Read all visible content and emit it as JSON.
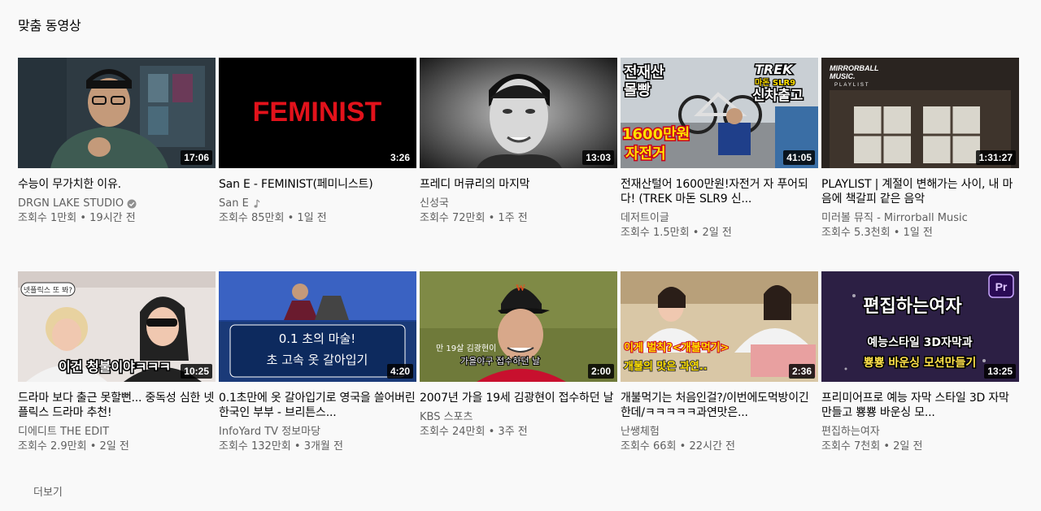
{
  "section": {
    "title": "맞춤 동영상",
    "more_label": "더보기"
  },
  "videos": [
    {
      "title": "수능이 무가치한 이유.",
      "channel": "DRGN LAKE STUDIO",
      "badge": "verified-icon",
      "views": "조회수 1만회",
      "age": "19시간 전",
      "duration": "17:06"
    },
    {
      "title": "San E - FEMINIST(페미니스트)",
      "channel": "San E",
      "badge": "music-note-icon",
      "views": "조회수 85만회",
      "age": "1일 전",
      "duration": "3:26",
      "thumb_text": "FEMINIST"
    },
    {
      "title": "프레디 머큐리의 마지막",
      "channel": "신성국",
      "views": "조회수 72만회",
      "age": "1주 전",
      "duration": "13:03"
    },
    {
      "title": "전재산털어 1600만원!자전거 자 푸어되다! (TREK 마돈 SLR9 신...",
      "channel": "데저트이글",
      "views": "조회수 1.5만회",
      "age": "2일 전",
      "duration": "41:05",
      "thumb_text": [
        "전재산",
        "몰빵",
        "TREK",
        "마돈 SLR9",
        "신차출고",
        "1600만원",
        "자전거"
      ]
    },
    {
      "title": "PLAYLIST | 계절이 변해가는 사이, 내 마음에 책갈피 같은 음악",
      "channel": "미러볼 뮤직 - Mirrorball Music",
      "views": "조회수 5.3천회",
      "age": "1일 전",
      "duration": "1:31:27",
      "thumb_text": [
        "MIRRORBALL",
        "MUSIC.",
        "PLAYLIST"
      ]
    },
    {
      "title": "드라마 보다 출근 못할뻔... 중독성 심한 넷플릭스 드라마 추천!",
      "channel": "디에디트 THE EDIT",
      "views": "조회수 2.9만회",
      "age": "2일 전",
      "duration": "10:25",
      "thumb_text": [
        "넷플릭스 또 봐?",
        "이건 청불이야ㅋㅋㅋ"
      ]
    },
    {
      "title": "0.1초만에 옷 갈아입기로 영국을 쓸어버린 한국인 부부 - 브리튼스...",
      "channel": "InfoYard TV 정보마당",
      "views": "조회수 132만회",
      "age": "3개월 전",
      "duration": "4:20",
      "thumb_text": [
        "0.1 초의 마술!",
        "초 고속 옷 갈아입기"
      ]
    },
    {
      "title": "2007년 가을 19세 김광현이 접수하던 날",
      "channel": "KBS 스포츠",
      "views": "조회수 24만회",
      "age": "3주 전",
      "duration": "2:00",
      "thumb_text": [
        "만 19살 김광현이",
        "가을야구 접수하던 날"
      ]
    },
    {
      "title": "개불먹기는 처음인걸?/이번에도먹방이긴한데/ㅋㅋㅋㅋㅋ과연맛은...",
      "channel": "난쌩체험",
      "views": "조회수 66회",
      "age": "22시간 전",
      "duration": "2:36",
      "thumb_text": [
        "이게 벌칙?<개불먹기>",
        "개불의 맛은 과연.."
      ]
    },
    {
      "title": "프리미어프로 예능 자막 스타일 3D 자막 만들고 뿅뿅 바운싱 모...",
      "channel": "편집하는여자",
      "views": "조회수 7천회",
      "age": "2일 전",
      "duration": "13:25",
      "thumb_text": [
        "Pr",
        "편집하는여자",
        "예능스타일 3D자막과",
        "뿅뿅 바운싱 모션만들기"
      ]
    }
  ],
  "colors": {
    "meta": "#606060",
    "background": "#f9f9f9",
    "text": "#030303"
  }
}
